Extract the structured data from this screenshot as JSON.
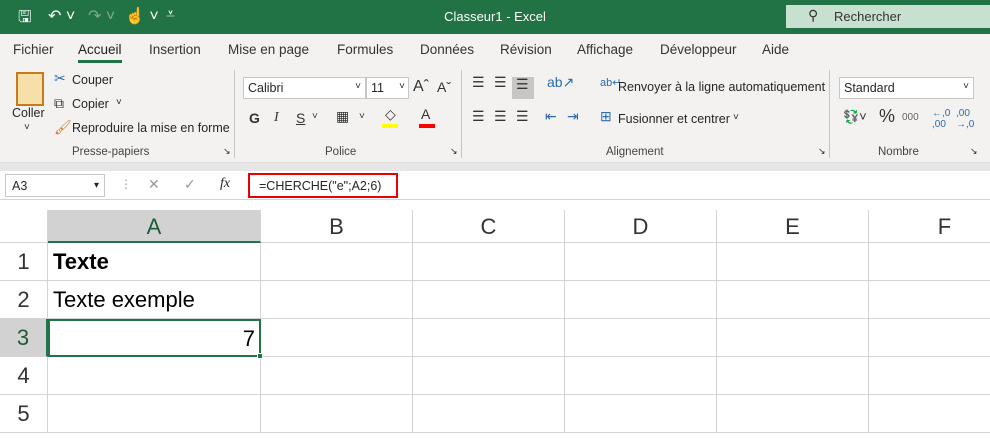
{
  "titlebar": {
    "title": "Classeur1  -  Excel",
    "search_placeholder": "Rechercher",
    "icons": [
      "save-icon",
      "undo-icon",
      "redo-icon",
      "touch-mode-icon",
      "customize-icon"
    ]
  },
  "tabs": [
    "Fichier",
    "Accueil",
    "Insertion",
    "Mise en page",
    "Formules",
    "Données",
    "Révision",
    "Affichage",
    "Développeur",
    "Aide"
  ],
  "clipboard": {
    "paste": "Coller",
    "cut": "Couper",
    "copy": "Copier",
    "format_painter": "Reproduire la mise en forme",
    "group": "Presse-papiers"
  },
  "font": {
    "name": "Calibri",
    "size": "11",
    "bold": "G",
    "italic": "I",
    "underline": "S",
    "group": "Police",
    "fill_color": "#ffff00",
    "font_color": "#ff0000"
  },
  "alignment": {
    "wrap": "Renvoyer à la ligne automatiquement",
    "merge": "Fusionner et centrer",
    "group": "Alignement"
  },
  "number": {
    "format": "Standard",
    "percent": "%",
    "thousands": "000",
    "group": "Nombre"
  },
  "formula_bar": {
    "name_box": "A3",
    "fx": "fx",
    "formula": "=CHERCHE(\"e\";A2;6)"
  },
  "sheet": {
    "columns": [
      "A",
      "B",
      "C",
      "D",
      "E",
      "F"
    ],
    "rows": [
      "1",
      "2",
      "3",
      "4",
      "5"
    ],
    "cells": {
      "A1": "Texte",
      "A2": "Texte exemple",
      "A3": "7"
    },
    "selected": "A3"
  }
}
